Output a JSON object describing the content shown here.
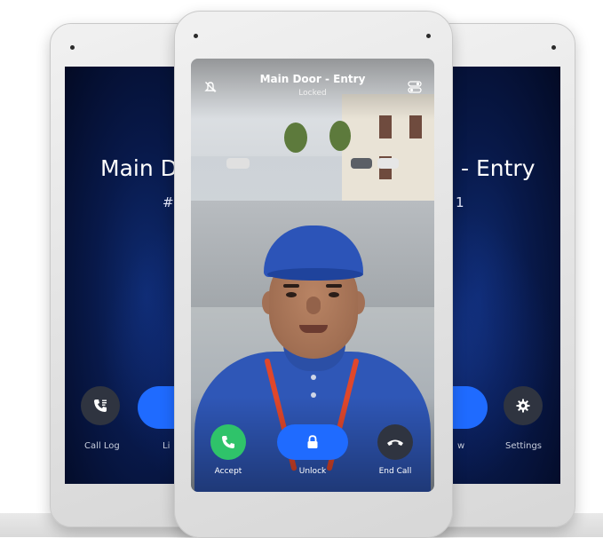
{
  "back_left": {
    "title_partial": "Main Do",
    "sub_partial": "#",
    "call_log_label": "Call Log",
    "second_label_partial": "Li"
  },
  "back_right": {
    "title_partial": "- Entry",
    "sub_partial": "1",
    "left_label_partial": "w",
    "settings_label": "Settings"
  },
  "front": {
    "title": "Main Door - Entry",
    "status": "Locked",
    "accept_label": "Accept",
    "unlock_label": "Unlock",
    "end_call_label": "End Call"
  },
  "colors": {
    "accept": "#2fc36a",
    "unlock": "#1f6bff",
    "end_call": "#2f3440",
    "screen_dark": "#030a24"
  },
  "icons": [
    "mute-icon",
    "toggle-icon",
    "phone-icon",
    "lock-icon",
    "end-call-icon",
    "call-log-icon",
    "gear-icon"
  ]
}
